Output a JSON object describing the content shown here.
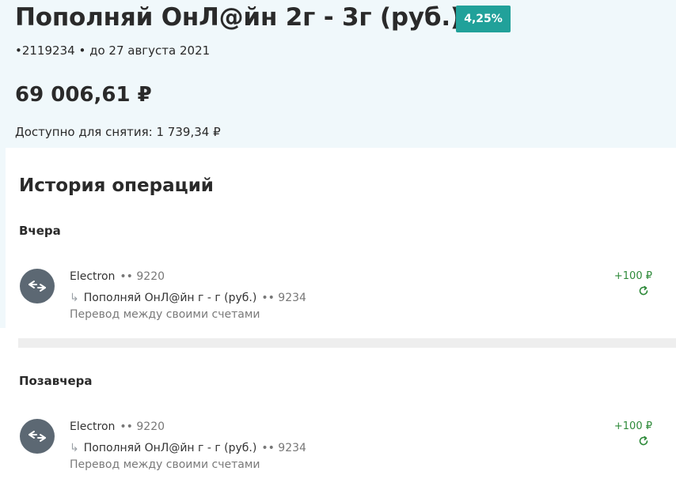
{
  "account": {
    "title": "Пополняй ОнЛ@йн 2г - 3г (руб.)",
    "rate": "4,25%",
    "number": "•2119234",
    "separator": "•",
    "term": "до 27 августа 2021",
    "balance": "69 006,61 ₽",
    "available_label": "Доступно для снятия:",
    "available_value": "1 739,34 ₽"
  },
  "history": {
    "title": "История операций",
    "groups": [
      {
        "label": "Вчера",
        "operations": [
          {
            "source_name": "Electron",
            "source_mask": "•• 9220",
            "dest_arrow": "↳",
            "dest_name": "Пополняй ОнЛ@йн г - г (руб.)",
            "dest_mask": "•• 9234",
            "description": "Перевод между своими счетами",
            "amount": "+100 ₽",
            "icon": "transfer-arrows-icon",
            "action_icon": "repeat-icon"
          }
        ]
      },
      {
        "label": "Позавчера",
        "operations": [
          {
            "source_name": "Electron",
            "source_mask": "•• 9220",
            "dest_arrow": "↳",
            "dest_name": "Пополняй ОнЛ@йн г - г (руб.)",
            "dest_mask": "•• 9234",
            "description": "Перевод между своими счетами",
            "amount": "+100 ₽",
            "icon": "transfer-arrows-icon",
            "action_icon": "repeat-icon"
          }
        ]
      }
    ]
  },
  "colors": {
    "header_bg": "#f0f8fb",
    "badge": "#21a19a",
    "icon_bg": "#5c6873",
    "positive": "#2e8a3a"
  }
}
